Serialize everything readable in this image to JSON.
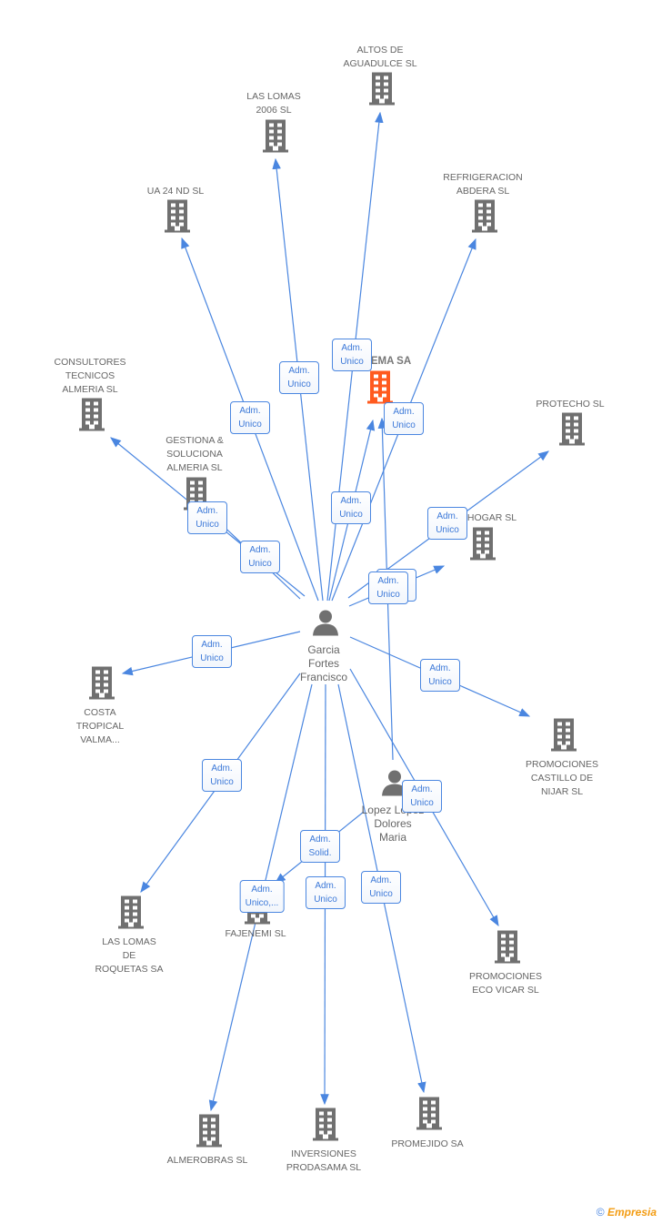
{
  "colors": {
    "edge": "#4a86e0",
    "building": "#707070",
    "highlight": "#ff5a1f"
  },
  "nodes": [
    {
      "id": "altos",
      "label": "ALTOS DE\nAGUADULCE SL",
      "type": "company"
    },
    {
      "id": "lomas2006",
      "label": "LAS LOMAS\n2006 SL",
      "type": "company"
    },
    {
      "id": "ua24",
      "label": "UA 24 ND SL",
      "type": "company"
    },
    {
      "id": "refrig",
      "label": "REFRIGERACION\nABDERA SL",
      "type": "company"
    },
    {
      "id": "consult",
      "label": "CONSULTORES\nTECNICOS\nALMERIA SL",
      "type": "company"
    },
    {
      "id": "ema",
      "label": "EMA SA",
      "type": "company-highlight"
    },
    {
      "id": "protecho",
      "label": "PROTECHO SL",
      "type": "company"
    },
    {
      "id": "gestiona",
      "label": "GESTIONA &\nSOLUCIONA\nALMERIA SL",
      "type": "company"
    },
    {
      "id": "hogar",
      "label": "HOGAR SL",
      "type": "company"
    },
    {
      "id": "garcia",
      "label": "Garcia\nFortes\nFrancisco",
      "type": "person"
    },
    {
      "id": "costa",
      "label": "COSTA\nTROPICAL\nVALMA...",
      "type": "company"
    },
    {
      "id": "castillo",
      "label": "PROMOCIONES\nCASTILLO DE\nNIJAR SL",
      "type": "company"
    },
    {
      "id": "lopez",
      "label": "Lopez Lopez\nDolores\nMaria",
      "type": "person"
    },
    {
      "id": "roquetas",
      "label": "LAS LOMAS\nDE\nROQUETAS SA",
      "type": "company"
    },
    {
      "id": "fajenemi",
      "label": "FAJENEMI SL",
      "type": "company"
    },
    {
      "id": "ecovicar",
      "label": "PROMOCIONES\nECO VICAR SL",
      "type": "company"
    },
    {
      "id": "almerobras",
      "label": "ALMEROBRAS SL",
      "type": "company"
    },
    {
      "id": "prodasama",
      "label": "INVERSIONES\nPRODASAMA SL",
      "type": "company"
    },
    {
      "id": "promejido",
      "label": "PROMEJIDO SA",
      "type": "company"
    }
  ],
  "edges": [
    {
      "from": "garcia",
      "to": "altos",
      "label": "Adm.\nUnico"
    },
    {
      "from": "garcia",
      "to": "lomas2006",
      "label": "Adm.\nUnico"
    },
    {
      "from": "garcia",
      "to": "ua24",
      "label": "Adm.\nUnico"
    },
    {
      "from": "garcia",
      "to": "refrig",
      "label": "Adm.\nUnico"
    },
    {
      "from": "garcia",
      "to": "ema",
      "label": "Adm.\nUnico"
    },
    {
      "from": "garcia",
      "to": "consult",
      "label": "Adm.\nUnico"
    },
    {
      "from": "garcia",
      "to": "gestiona",
      "label": "Adm.\nUnico"
    },
    {
      "from": "garcia",
      "to": "protecho",
      "label": "Adm.\nUnico"
    },
    {
      "from": "garcia",
      "to": "hogar",
      "label": "Adm.\nUnico"
    },
    {
      "from": "lopez",
      "to": "ema",
      "label": "Adm.\nUnico"
    },
    {
      "from": "garcia",
      "to": "costa",
      "label": "Adm.\nUnico"
    },
    {
      "from": "garcia",
      "to": "castillo",
      "label": "Adm.\nUnico"
    },
    {
      "from": "garcia",
      "to": "roquetas",
      "label": "Adm.\nUnico"
    },
    {
      "from": "garcia",
      "to": "ecovicar",
      "label": "Adm.\nUnico"
    },
    {
      "from": "garcia",
      "to": "almerobras",
      "label": "Adm.\nUnico,..."
    },
    {
      "from": "lopez",
      "to": "fajenemi",
      "label": "Adm.\nSolid."
    },
    {
      "from": "garcia",
      "to": "prodasama",
      "label": "Adm.\nUnico"
    },
    {
      "from": "garcia",
      "to": "promejido",
      "label": "Adm.\nUnico"
    }
  ],
  "footer": {
    "copyright": "©",
    "brand": "Empresia"
  }
}
